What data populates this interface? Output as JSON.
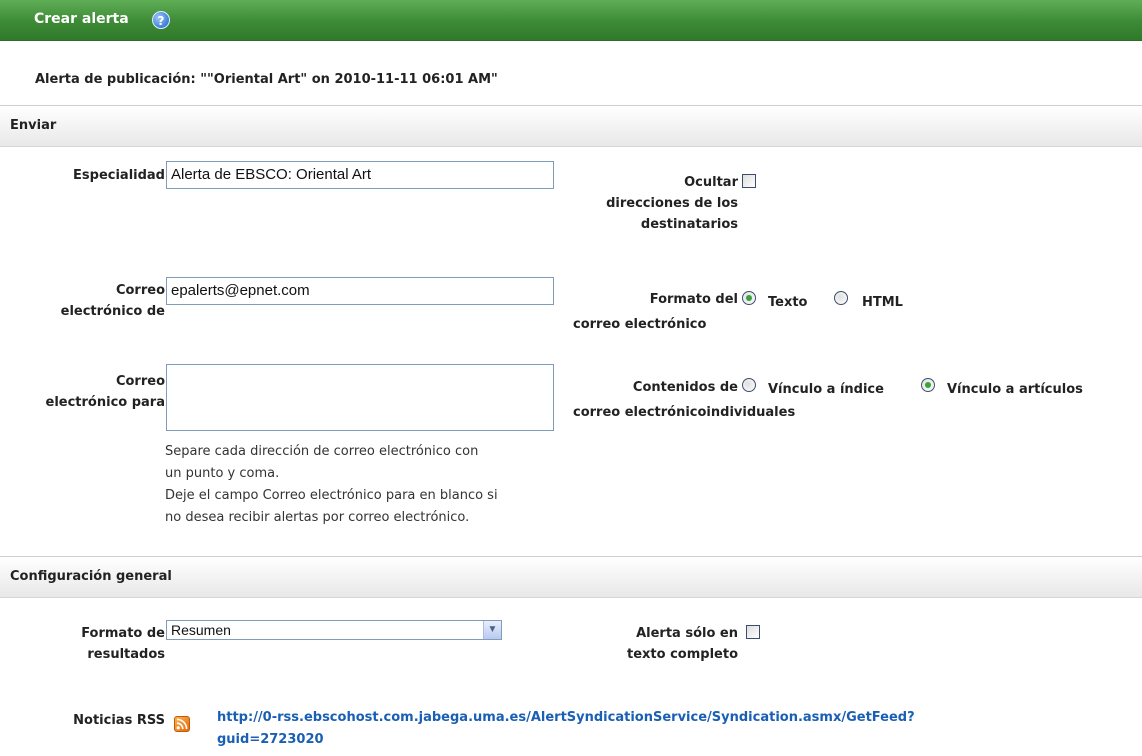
{
  "header": {
    "title": "Crear alerta",
    "help_glyph": "?"
  },
  "publication_title": "Alerta de publicación: \"\"Oriental Art\" on 2010-11-11 06:01 AM\"",
  "sections": {
    "send": "Enviar",
    "general": "Configuración general"
  },
  "send": {
    "subject_label": "Especialidad",
    "subject_value": "Alerta de EBSCO: Oriental Art",
    "from_label_1": "Correo",
    "from_label_2": "electrónico de",
    "from_value": "epalerts@epnet.com",
    "to_label_1": "Correo",
    "to_label_2": "electrónico para",
    "to_value": "",
    "note_1a": "Separe cada dirección de correo electrónico con",
    "note_1b": "un punto y coma.",
    "note_2a": "Deje el campo Correo electrónico para en blanco si",
    "note_2b": "no desea recibir alertas por correo electrónico.",
    "hide_label_1": "Ocultar",
    "hide_label_2": "direcciones de los",
    "hide_label_3": "destinatarios",
    "format_label_1": "Formato del",
    "format_label_2": "correo electrónico",
    "format_text": "Texto",
    "format_html": "HTML",
    "contents_label_1": "Contenidos de",
    "contents_label_2": "correo electrónicoindividuales",
    "contents_index": "Vínculo a índice",
    "contents_articles": "Vínculo a artículos"
  },
  "general": {
    "results_label_1": "Formato de",
    "results_label_2": "resultados",
    "results_value": "Resumen",
    "fulltext_label_1": "Alerta sólo en",
    "fulltext_label_2": "texto completo",
    "rss_label": "Noticias RSS",
    "rss_link_1": "http://0-rss.ebscohost.com.jabega.uma.es/AlertSyndicationService/Syndication.asmx/GetFeed?",
    "rss_link_2": "guid=2723020"
  },
  "state": {
    "hide_recipients": false,
    "email_format": "Texto",
    "email_contents": "Vínculo a artículos",
    "fulltext_only": false
  },
  "colors": {
    "header_green": "#3d8a36",
    "link_blue": "#1a5fb4",
    "radio_dot": "#39a23a"
  },
  "icons": [
    "help-icon",
    "rss-icon",
    "chevron-down-icon"
  ]
}
